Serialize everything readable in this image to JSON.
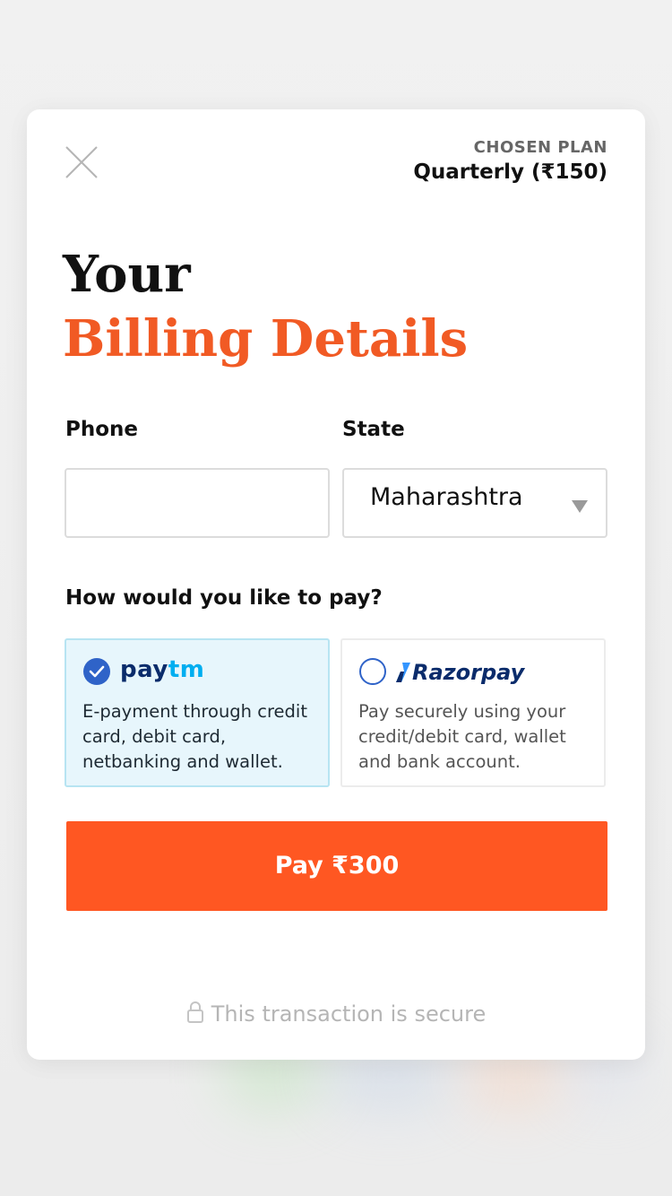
{
  "plan": {
    "label": "CHOSEN PLAN",
    "value": "Quarterly (₹150)"
  },
  "heading": {
    "line1": "Your",
    "line2": "Billing Details"
  },
  "form": {
    "phone_label": "Phone",
    "phone_value": "",
    "state_label": "State",
    "state_value": "Maharashtra"
  },
  "payment": {
    "question": "How would you like to pay?",
    "options": [
      {
        "brand": "paytm",
        "logo_part1": "pay",
        "logo_part2": "tm",
        "selected": true,
        "description": "E-payment through credit card, debit card, netbanking and wallet."
      },
      {
        "brand": "razorpay",
        "logo_text": "Razorpay",
        "selected": false,
        "description": "Pay securely using your credit/debit card, wallet and bank account."
      }
    ]
  },
  "pay_button": {
    "label": "Pay ₹300"
  },
  "footer": {
    "secure_text": "This transaction is secure"
  },
  "colors": {
    "accent": "#ff5722",
    "heading_accent": "#f15a24",
    "selected_bg": "#e7f6fc",
    "radio": "#2f63c8"
  },
  "icons": {
    "close": "close-icon",
    "dropdown": "chevron-down-icon",
    "check": "check-icon",
    "lock": "lock-icon"
  }
}
